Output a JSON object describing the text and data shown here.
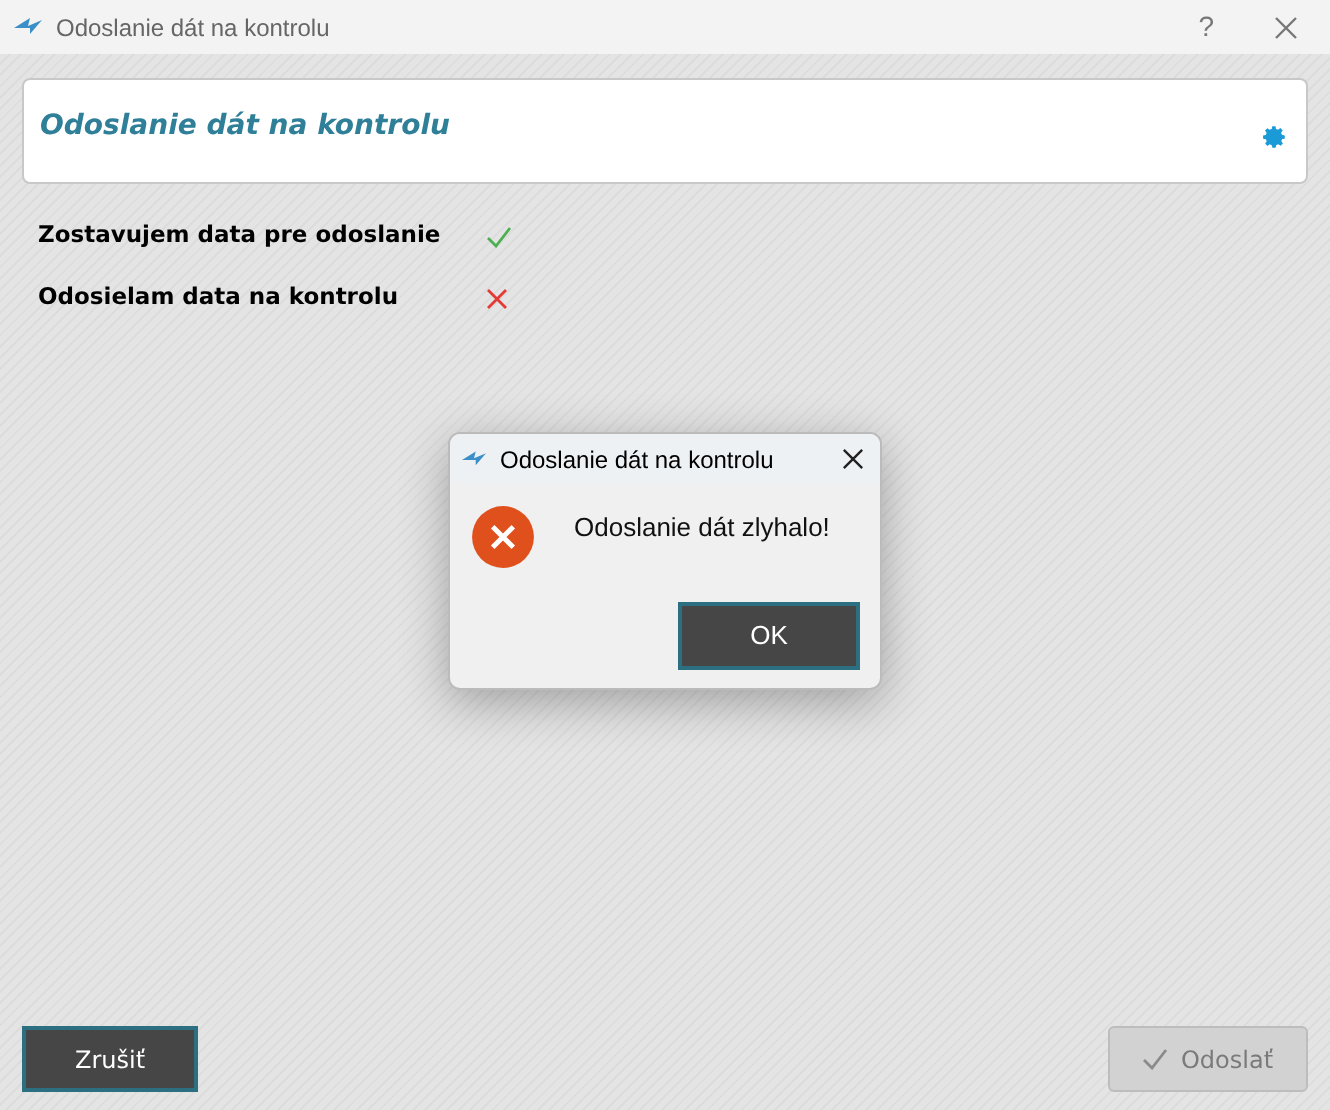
{
  "window": {
    "title": "Odoslanie dát na kontrolu",
    "help": "?"
  },
  "header": {
    "title": "Odoslanie dát na kontrolu"
  },
  "steps": [
    {
      "label": "Zostavujem data pre odoslanie",
      "succeeded": true
    },
    {
      "label": "Odosielam data na kontrolu",
      "succeeded": false
    }
  ],
  "dialog": {
    "title": "Odoslanie dát na kontrolu",
    "message": "Odoslanie dát zlyhalo!",
    "button": "OK"
  },
  "buttons": [
    {
      "label": "Zrušiť",
      "disabled": false,
      "kind": "cancel"
    },
    {
      "label": "Odoslať",
      "disabled": true,
      "kind": "send"
    }
  ]
}
